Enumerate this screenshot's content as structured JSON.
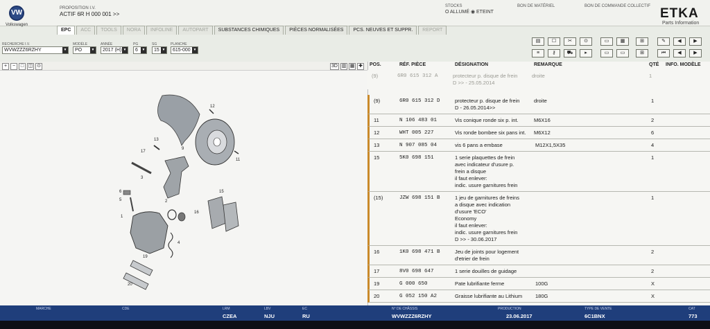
{
  "header": {
    "brand": "Volkswagen",
    "logo_letters": "VW",
    "proposition_label": "PROPOSITION I.V.",
    "proposition_value": "ACTIF  6R H 000 001 >>",
    "stocks_label": "STOCKS",
    "stocks_options": "O ALLUMÉ  ◉ ETEINT",
    "bom_label": "BON DE MATÉRIEL",
    "order_label": "BON DE COMMANDE COLLECTIF",
    "app_title": "ETKA",
    "app_subtitle": "Parts Information"
  },
  "tabs": [
    {
      "label": "EPC",
      "state": "active"
    },
    {
      "label": "ACC",
      "state": "disabled"
    },
    {
      "label": "TOOLS",
      "state": "disabled"
    },
    {
      "label": "NORA",
      "state": "disabled"
    },
    {
      "label": "INFOLINE",
      "state": "disabled"
    },
    {
      "label": "AUTOPART",
      "state": "disabled"
    },
    {
      "label": "SUBSTANCES CHIMIQUES",
      "state": "enabled"
    },
    {
      "label": "PIÈCES NORMALISÉES",
      "state": "enabled"
    },
    {
      "label": "PCS. NEUVES ET SUPPR.",
      "state": "enabled"
    },
    {
      "label": "REPORT",
      "state": "disabled"
    }
  ],
  "search": {
    "vin_label": "RECHERCHE I.V.",
    "vin_value": "WVWZZZ6RZHY",
    "model_label": "MODÈLE",
    "model_value": "PO",
    "year_label": "ANNÉE",
    "year_value": "2017 (H)",
    "pg_label": "PG",
    "pg_value": "6",
    "sg_label": "SG",
    "sg_value": "15",
    "plate_label": "PLANCHE",
    "plate_value": "615-000"
  },
  "image_toolbar": {
    "btn_3d": "3D"
  },
  "table": {
    "headers": {
      "pos": "POS.",
      "ref": "RÉF. PIÈCE",
      "desc": "DÉSIGNATION",
      "remark": "REMARQUE",
      "qty": "QTÉ",
      "info": "INFO. MODÈLE"
    },
    "rows": [
      {
        "pos": "(9)",
        "ref": "6R0  615  312  A",
        "desc": [
          "protecteur p. disque de frein",
          "D          >> - 25.05.2014"
        ],
        "remark": "droite",
        "remark2": "",
        "qty": "1",
        "style": "grey"
      },
      {
        "pos": "(9)",
        "ref": "6R0  615  312  D",
        "desc": [
          "protecteur p. disque de frein",
          "D - 26.05.2014>>"
        ],
        "remark": "droite",
        "remark2": "",
        "qty": "1",
        "style": "bar"
      },
      {
        "pos": "11",
        "ref": "N    106  483  01",
        "desc": [
          "Vis conique ronde six p. int."
        ],
        "remark": "M6X16",
        "remark2": "",
        "qty": "2",
        "style": "bar"
      },
      {
        "pos": "12",
        "ref": "WHT  005  227",
        "desc": [
          "Vis ronde bombee six pans int."
        ],
        "remark": "M6X12",
        "remark2": "",
        "qty": "6",
        "style": "bar"
      },
      {
        "pos": "13",
        "ref": "N    907  085  04",
        "desc": [
          "vis 6 pans a embase"
        ],
        "remark": "",
        "remark2": "M12X1,5X35",
        "qty": "4",
        "style": "bar"
      },
      {
        "pos": "15",
        "ref": "5K0  698  151",
        "desc": [
          "1 serie plaquettes de frein",
          "avec indicateur d'usure p.",
          "frein a disque",
          "                         il faut enlever:",
          "indic. usure garnitures frein"
        ],
        "remark": "",
        "remark2": "",
        "qty": "1",
        "style": "bar"
      },
      {
        "pos": "(15)",
        "ref": "JZW  698  151  B",
        "desc": [
          "1 jeu de garnitures de freins",
          "a disque avec indication",
          "d'usure             'ECO'",
          "Economy",
          "                         il faut enlever:",
          "indic. usure garnitures frein",
          "D           >> - 30.06.2017"
        ],
        "remark": "",
        "remark2": "",
        "qty": "1",
        "style": "bar"
      },
      {
        "pos": "16",
        "ref": "1K0  698  471  B",
        "desc": [
          "Jeu de joints pour logement",
          "d'etrier de frein"
        ],
        "remark": "",
        "remark2": "",
        "qty": "2",
        "style": "bar"
      },
      {
        "pos": "17",
        "ref": "8V0  698  647",
        "desc": [
          "1 serie douilles de guidage"
        ],
        "remark": "",
        "remark2": "",
        "qty": "2",
        "style": "bar"
      },
      {
        "pos": "19",
        "ref": "G    000  650",
        "desc": [
          "Pate lubrifiante ferme"
        ],
        "remark": "",
        "remark2": "100G",
        "qty": "X",
        "style": "bar"
      },
      {
        "pos": "20",
        "ref": "G    052  150  A2",
        "desc": [
          "Graisse lubrifiante au Lithium"
        ],
        "remark": "",
        "remark2": "180G",
        "qty": "X",
        "style": "bar"
      }
    ]
  },
  "diagram": {
    "callouts": [
      "9",
      "12",
      "11",
      "13",
      "17",
      "3",
      "2",
      "6",
      "5",
      "1",
      "16",
      "15",
      "4",
      "19",
      "20"
    ]
  },
  "status": {
    "marche_label": "MARCHE",
    "cde_label": "CDE",
    "lrm_label": "LRM",
    "lrm_value": "CZEA",
    "lbv_label": "LBV",
    "lbv_value": "NJU",
    "ec_label": "EC",
    "ec_value": "RU",
    "chassis_label": "N° DE CHÂSSIS",
    "chassis_value": "WVWZZZ6RZHY",
    "production_label": "PRODUCTION",
    "production_value": "23.06.2017",
    "sale_label": "TYPE DE VENTE",
    "sale_value": "6C1BNX",
    "cat_label": "CAT",
    "cat_value": "773"
  },
  "colors": {
    "status_bar": "#1f3e7b",
    "row_accent": "#c98a2a"
  }
}
